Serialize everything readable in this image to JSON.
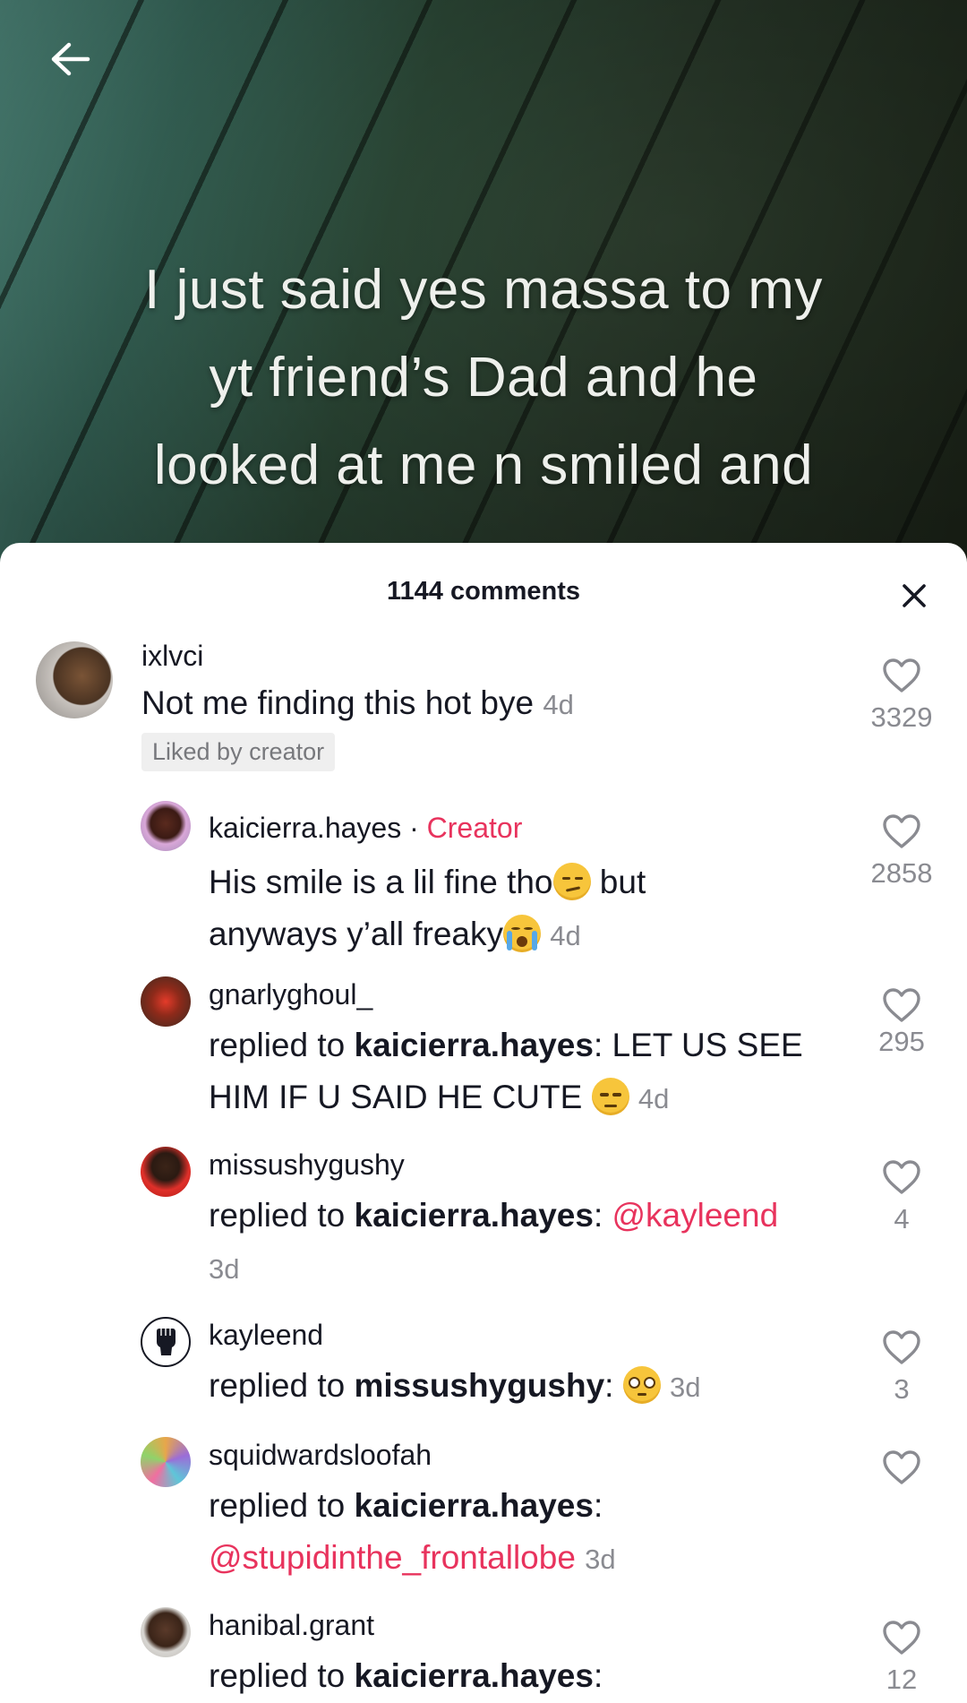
{
  "video": {
    "caption": "I just said yes massa to my\nyt friend’s Dad and he\nlooked at me n smiled and"
  },
  "icons": {
    "back": "arrow-left-icon",
    "close": "close-x-icon",
    "like": "heart-outline-icon"
  },
  "colors": {
    "accent": "#e8335d",
    "muted": "#8a8b91",
    "text": "#161823"
  },
  "sheet": {
    "title": "1144 comments"
  },
  "comments": [
    {
      "username": "ixlvci",
      "text": "Not me finding this hot bye",
      "time": "4d",
      "likes": "3329",
      "badge": "Liked by creator"
    },
    {
      "username": "kaicierra.hayes",
      "separator": "·",
      "creator_label": "Creator",
      "text_a": "His smile is a lil fine tho",
      "text_b": " but",
      "text_c": "anyways y’all freaky",
      "time": "4d",
      "likes": "2858"
    },
    {
      "username": "gnarlyghoul_",
      "prefix": "replied to ",
      "replied_to": "kaicierra.hayes",
      "text": ": LET US SEE HIM IF U SAID HE CUTE",
      "time": "4d",
      "likes": "295"
    },
    {
      "username": "missushygushy",
      "prefix": "replied to ",
      "replied_to": "kaicierra.hayes",
      "colon": ": ",
      "mention": "@kayleend",
      "time": "3d",
      "likes": "4"
    },
    {
      "username": "kayleend",
      "prefix": "replied to ",
      "replied_to": "missushygushy",
      "colon": ":",
      "time": "3d",
      "likes": "3"
    },
    {
      "username": "squidwardsloofah",
      "prefix": "replied to ",
      "replied_to": "kaicierra.hayes",
      "colon": ":",
      "mention": "@stupidinthe_frontallobe",
      "time": "3d"
    },
    {
      "username": "hanibal.grant",
      "prefix": "replied to ",
      "replied_to": "kaicierra.hayes",
      "colon": ":",
      "likes": "12"
    }
  ]
}
